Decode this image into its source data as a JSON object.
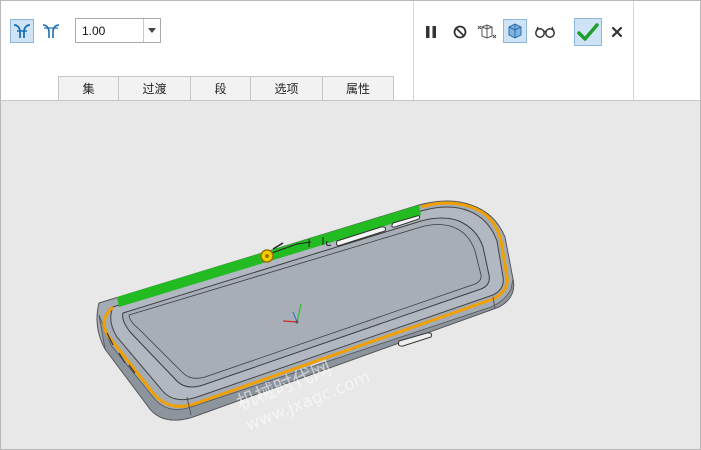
{
  "toolbar": {
    "mode_a_icon": "tangent-chain-round-icon",
    "mode_b_icon": "through-curve-round-icon",
    "radius_value": "1.00"
  },
  "tabs": [
    {
      "label": "集"
    },
    {
      "label": "过渡"
    },
    {
      "label": "段"
    },
    {
      "label": "选项"
    },
    {
      "label": "属性"
    }
  ],
  "controls": {
    "pause_icon": "pause-icon",
    "stop_icon": "no-preview-icon",
    "geometry_preview_icon": "geometry-preview-icon",
    "verify_icon": "verify-mode-icon",
    "glasses_icon": "preview-glasses-icon",
    "ok_icon": "checkmark-icon",
    "cancel_icon": "close-icon"
  },
  "viewport": {
    "watermark_line1": "机械时代网",
    "watermark_line2": "www.jxagc.com"
  },
  "colors": {
    "selection_green": "#22bb22",
    "edge_highlight": "#f2a000",
    "model_fill": "#a3abb5",
    "ok_green": "#1e9e2c"
  }
}
